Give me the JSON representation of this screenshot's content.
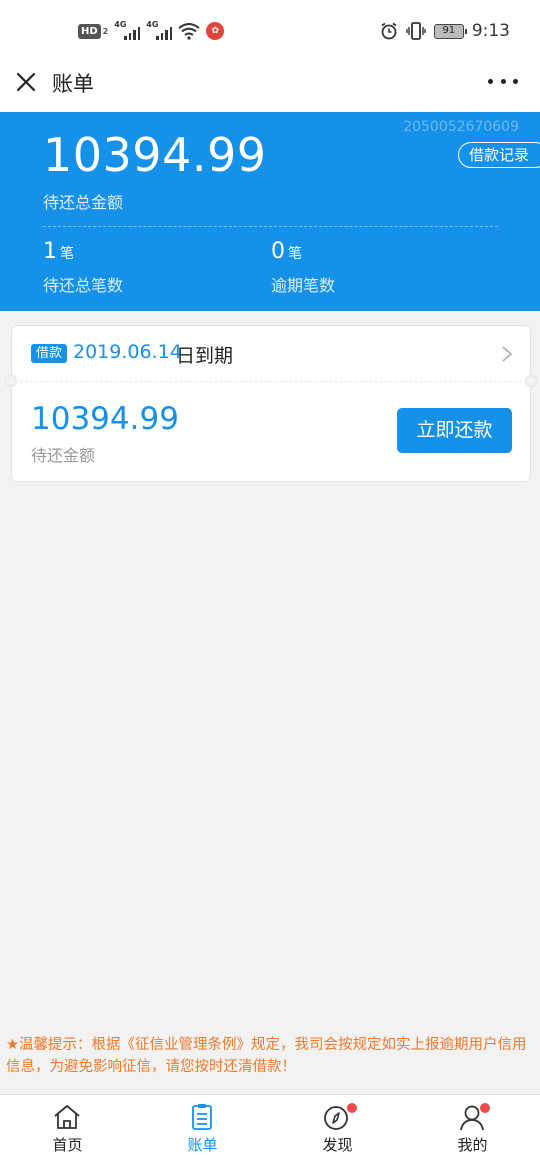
{
  "status_bar": {
    "hd_label": "HD",
    "hd_sub": "2",
    "network_1": "4G",
    "network_2": "4G",
    "carrier_logo": "China Mobile",
    "battery": "91",
    "time": "9:13"
  },
  "nav": {
    "title": "账单"
  },
  "summary": {
    "account_no": "2050052670609",
    "record_button": "借款记录",
    "total_amount": "10394.99",
    "total_label": "待还总金额",
    "pending_count": "1",
    "pending_unit": "笔",
    "pending_label": "待还总笔数",
    "overdue_count": "0",
    "overdue_unit": "笔",
    "overdue_label": "逾期笔数"
  },
  "bill": {
    "tag": "借款",
    "due_date": "2019.06.14",
    "due_suffix": "日到期",
    "amount": "10394.99",
    "amount_label": "待还金额",
    "pay_button": "立即还款"
  },
  "notice": "★温馨提示：根据《征信业管理条例》规定，我司会按规定如实上报逾期用户信用信息，为避免影响征信，请您按时还清借款！",
  "tabs": [
    {
      "label": "首页",
      "icon": "home-icon"
    },
    {
      "label": "账单",
      "icon": "bill-icon"
    },
    {
      "label": "发现",
      "icon": "compass-icon"
    },
    {
      "label": "我的",
      "icon": "user-icon"
    }
  ],
  "colors": {
    "primary": "#1591ea",
    "notice": "#ee7a2d",
    "badge": "#ef4a4a"
  }
}
